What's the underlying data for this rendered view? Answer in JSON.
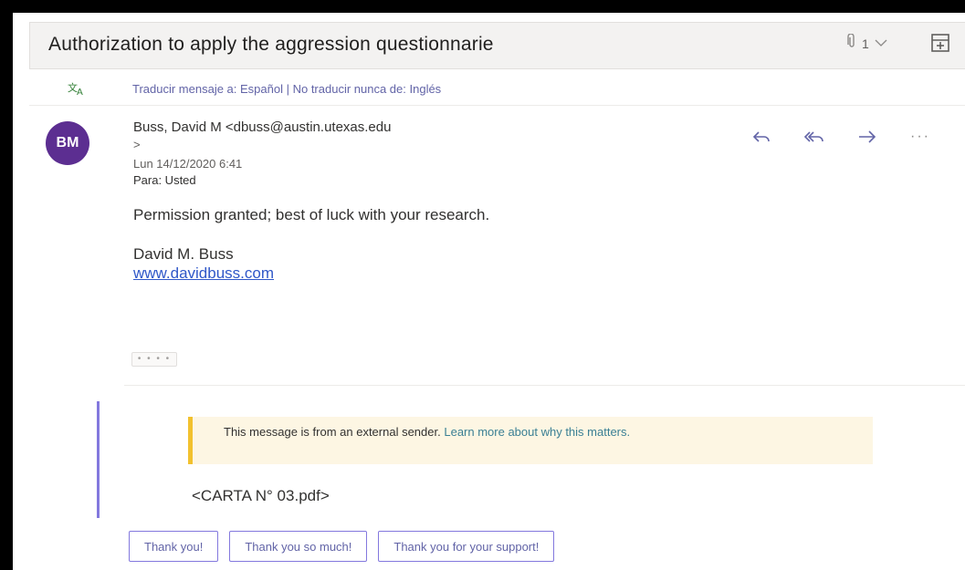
{
  "message": {
    "subject": "Authorization to apply the aggression questionnarie",
    "attachment_count": "1",
    "translate_bar": "Traducir mensaje a: Español | No traducir nunca de: Inglés",
    "sender": {
      "initials": "BM",
      "name_line": "Buss, David M <dbuss@austin.utexas.edu",
      "name_line_cont": ">",
      "date": "Lun 14/12/2020 6:41",
      "to": "Para: Usted",
      "avatar_color": "#5c2e91"
    },
    "body": "Permission granted; best of luck with your research.",
    "signature_name": "David M. Buss",
    "signature_link": "www.davidbuss.com",
    "show_more": "• • • •",
    "external_notice": {
      "text": "This message is from an external sender.",
      "link": "Learn more about why this matters."
    },
    "attachment_ref": "<CARTA N° 03.pdf>"
  },
  "quick_replies": [
    "Thank you!",
    "Thank you so much!",
    "Thank you for your support!"
  ],
  "icons": {
    "attachment": "paperclip-icon",
    "chevron": "chevron-down-icon",
    "popout": "popout-icon",
    "translate": "translate-icon",
    "reply": "reply-icon",
    "reply_all": "reply-all-icon",
    "forward": "forward-icon",
    "more": "more-icon"
  },
  "colors": {
    "accent": "#6264a7",
    "avatar": "#5c2e91",
    "warning_bar": "#f2c12e",
    "quote_bar": "#8378de",
    "link": "#2f57c8"
  }
}
